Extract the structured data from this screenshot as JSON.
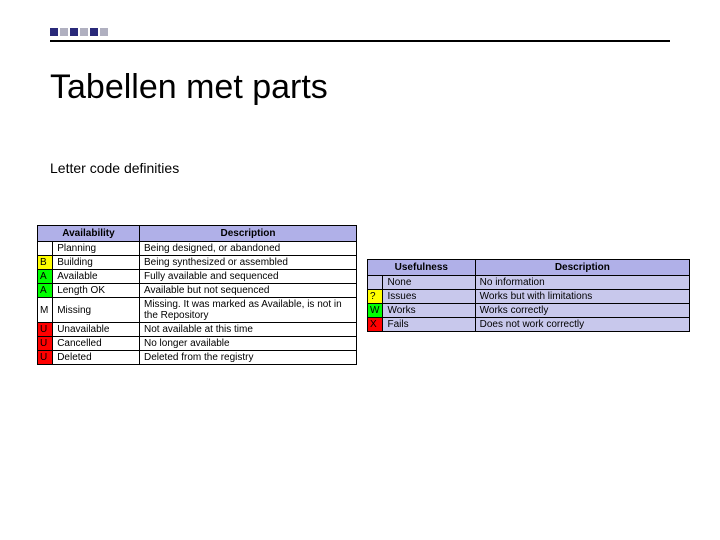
{
  "slide": {
    "title": "Tabellen met parts",
    "subtitle": "Letter code definities"
  },
  "availability_table": {
    "headers": {
      "h1": "Availability",
      "h2": "Description"
    },
    "rows": [
      {
        "code": "",
        "color": "bg-white",
        "avail": "Planning",
        "desc": "Being designed, or abandoned"
      },
      {
        "code": "B",
        "color": "bg-yellow",
        "avail": "Building",
        "desc": "Being synthesized or assembled"
      },
      {
        "code": "A",
        "color": "bg-green",
        "avail": "Available",
        "desc": "Fully available and sequenced"
      },
      {
        "code": "A",
        "color": "bg-green",
        "avail": "Length OK",
        "desc": "Available but not sequenced"
      },
      {
        "code": "M",
        "color": "bg-white",
        "avail": "Missing",
        "desc": "Missing. It was marked as Available, is not in the Repository"
      },
      {
        "code": "U",
        "color": "bg-red",
        "avail": "Unavailable",
        "desc": "Not available at this time"
      },
      {
        "code": "U",
        "color": "bg-red",
        "avail": "Cancelled",
        "desc": "No longer available"
      },
      {
        "code": "U",
        "color": "bg-red",
        "avail": "Deleted",
        "desc": "Deleted from the registry"
      }
    ]
  },
  "usefulness_table": {
    "headers": {
      "h1": "Usefulness",
      "h2": "Description"
    },
    "rows": [
      {
        "code": "",
        "color": "bg-lav",
        "use": "None",
        "desc": "No information"
      },
      {
        "code": "?",
        "color": "bg-yellow",
        "use": "Issues",
        "desc": "Works but with limitations"
      },
      {
        "code": "W",
        "color": "bg-green",
        "use": "Works",
        "desc": "Works correctly"
      },
      {
        "code": "X",
        "color": "bg-red",
        "use": "Fails",
        "desc": "Does not work correctly"
      }
    ]
  }
}
